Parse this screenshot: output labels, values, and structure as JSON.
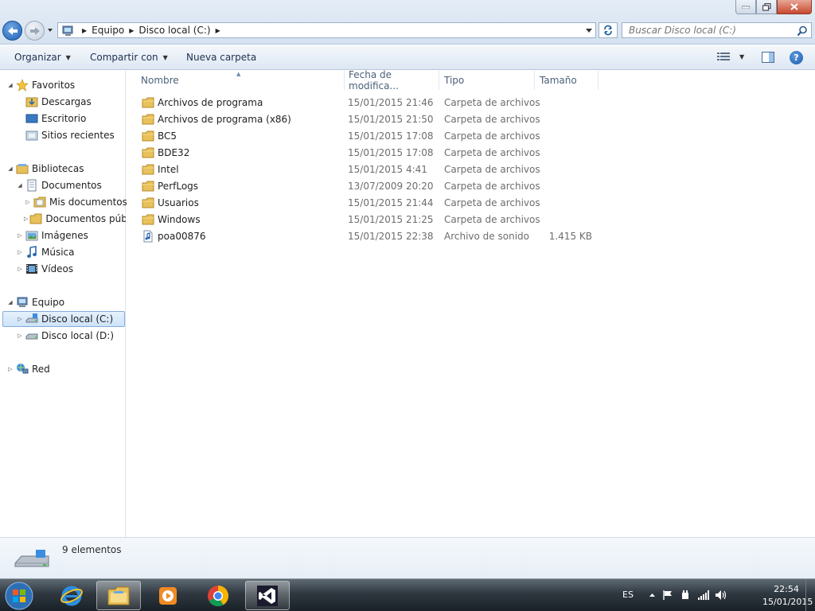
{
  "address": {
    "crumbs": [
      "Equipo",
      "Disco local (C:)"
    ]
  },
  "search": {
    "placeholder": "Buscar Disco local (C:)"
  },
  "toolbar": {
    "organize": "Organizar",
    "share": "Compartir con",
    "new_folder": "Nueva carpeta"
  },
  "nav": {
    "favorites": "Favoritos",
    "downloads": "Descargas",
    "desktop": "Escritorio",
    "recent": "Sitios recientes",
    "libraries": "Bibliotecas",
    "documents": "Documentos",
    "my_documents": "Mis documentos",
    "public_documents": "Documentos públicos",
    "pictures": "Imágenes",
    "music": "Música",
    "videos": "Vídeos",
    "computer": "Equipo",
    "drive_c": "Disco local (C:)",
    "drive_d": "Disco local (D:)",
    "network": "Red"
  },
  "columns": {
    "name": "Nombre",
    "date": "Fecha de modifica...",
    "type": "Tipo",
    "size": "Tamaño"
  },
  "files": [
    {
      "name": "Archivos de programa",
      "date": "15/01/2015 21:46",
      "type": "Carpeta de archivos",
      "size": "",
      "kind": "folder"
    },
    {
      "name": "Archivos de programa (x86)",
      "date": "15/01/2015 21:50",
      "type": "Carpeta de archivos",
      "size": "",
      "kind": "folder"
    },
    {
      "name": "BC5",
      "date": "15/01/2015 17:08",
      "type": "Carpeta de archivos",
      "size": "",
      "kind": "folder"
    },
    {
      "name": "BDE32",
      "date": "15/01/2015 17:08",
      "type": "Carpeta de archivos",
      "size": "",
      "kind": "folder"
    },
    {
      "name": "Intel",
      "date": "15/01/2015 4:41",
      "type": "Carpeta de archivos",
      "size": "",
      "kind": "folder"
    },
    {
      "name": "PerfLogs",
      "date": "13/07/2009 20:20",
      "type": "Carpeta de archivos",
      "size": "",
      "kind": "folder"
    },
    {
      "name": "Usuarios",
      "date": "15/01/2015 21:44",
      "type": "Carpeta de archivos",
      "size": "",
      "kind": "folder"
    },
    {
      "name": "Windows",
      "date": "15/01/2015 21:25",
      "type": "Carpeta de archivos",
      "size": "",
      "kind": "folder"
    },
    {
      "name": "poa00876",
      "date": "15/01/2015 22:38",
      "type": "Archivo de sonido",
      "size": "1.415 KB",
      "kind": "audio"
    }
  ],
  "status": {
    "count": "9 elementos"
  },
  "tray": {
    "lang": "ES",
    "time": "22:54",
    "date": "15/01/2015"
  },
  "colors": {
    "folder": "#e8c15a",
    "accent": "#1f5fb3",
    "selection": "#cde3fa"
  }
}
